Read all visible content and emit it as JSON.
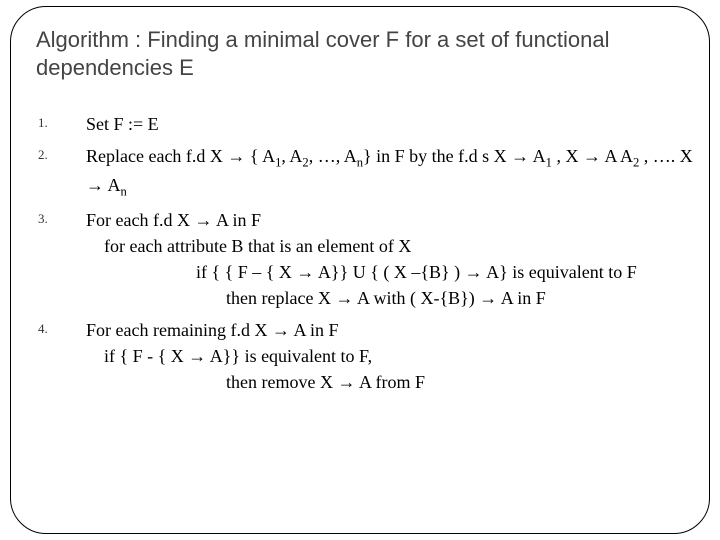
{
  "title": "Algorithm : Finding a minimal cover F for a set of functional dependencies E",
  "steps": {
    "s1": {
      "num": "1.",
      "text": "Set F := E"
    },
    "s2": {
      "num": "2.",
      "line_a_pre": "Replace each f.d X → { A",
      "line_a_mid1": ", A",
      "line_a_mid2": ", …, A",
      "line_a_post": "} in F by the f.d s    X → A",
      "line_a_tail": " , X → A",
      "line_b_mid": " , …. X → A"
    },
    "s3": {
      "num": "3.",
      "l1": "For each f.d X → A in F",
      "l2": "for each attribute B that is an element of X",
      "l3": "if { { F – { X → A}} U { ( X –{B} ) → A} is equivalent to F",
      "l4": "then replace X → A with ( X-{B}) → A in F"
    },
    "s4": {
      "num": "4.",
      "l1": "For each remaining f.d X → A in F",
      "l2": "if { F - { X → A}} is equivalent to F,",
      "l3": "then remove X → A from F"
    }
  },
  "subs": {
    "one": "1",
    "two": "2",
    "n": "n"
  }
}
